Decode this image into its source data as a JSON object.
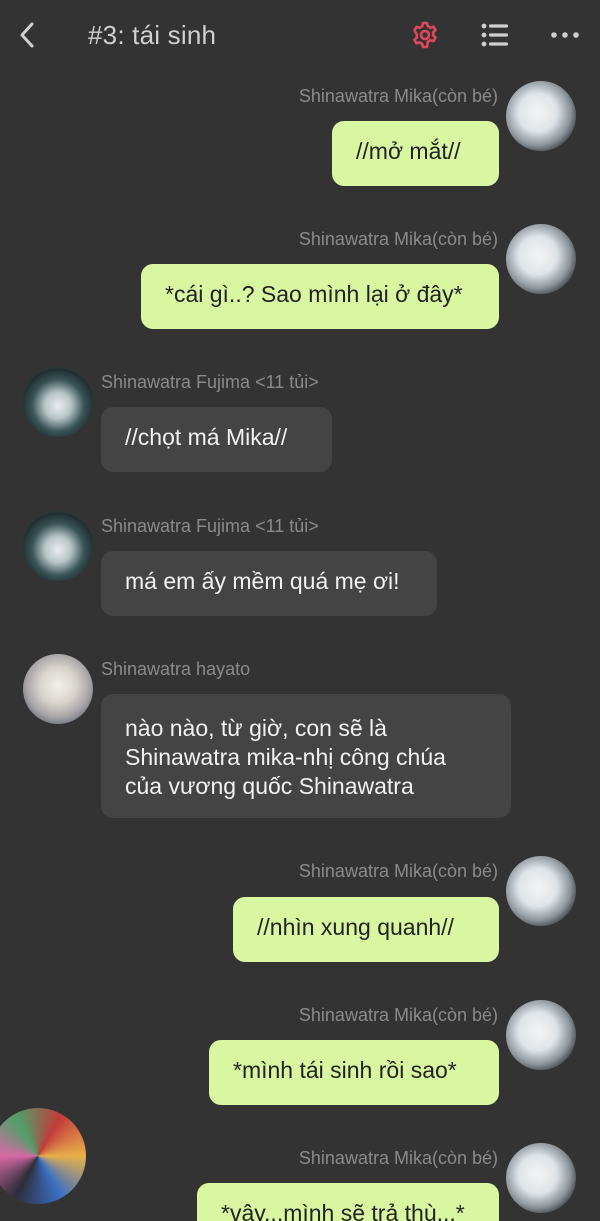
{
  "header": {
    "title": "#3: tái sinh",
    "icons": {
      "back": "chevron-left-icon",
      "settings": "gear-icon",
      "list": "list-icon",
      "more": "more-horizontal-icon"
    },
    "settings_color": "#e0475b"
  },
  "messages": [
    {
      "sender": "Shinawatra Mika(còn bé)",
      "text": "//mở mắt//",
      "mine": true
    },
    {
      "sender": "Shinawatra Mika(còn bé)",
      "text": "*cái gì..? Sao mình lại ở đây*",
      "mine": true
    },
    {
      "sender": "Shinawatra Fujima <11 tủi>",
      "text": "//chọt má Mika//",
      "mine": false
    },
    {
      "sender": "Shinawatra Fujima <11 tủi>",
      "text": "má em ấy mềm quá mẹ ơi!",
      "mine": false
    },
    {
      "sender": "Shinawatra hayato",
      "text_lines": [
        "nào nào, từ giờ, con sẽ là",
        "Shinawatra mika-nhị công chúa",
        "của vương quốc Shinawatra"
      ],
      "mine": false
    },
    {
      "sender": "Shinawatra Mika(còn bé)",
      "text": "//nhìn xung quanh//",
      "mine": true
    },
    {
      "sender": "Shinawatra Mika(còn bé)",
      "text": "*mình tái sinh rồi sao*",
      "mine": true
    },
    {
      "sender": "Shinawatra Mika(còn bé)",
      "text": "*vậy...mình sẽ trả thù...*",
      "mine": true
    }
  ],
  "colors": {
    "background": "#333333",
    "my_bubble": "#d9f7a1",
    "their_bubble": "#444444",
    "name_text": "#8a8a8a"
  }
}
